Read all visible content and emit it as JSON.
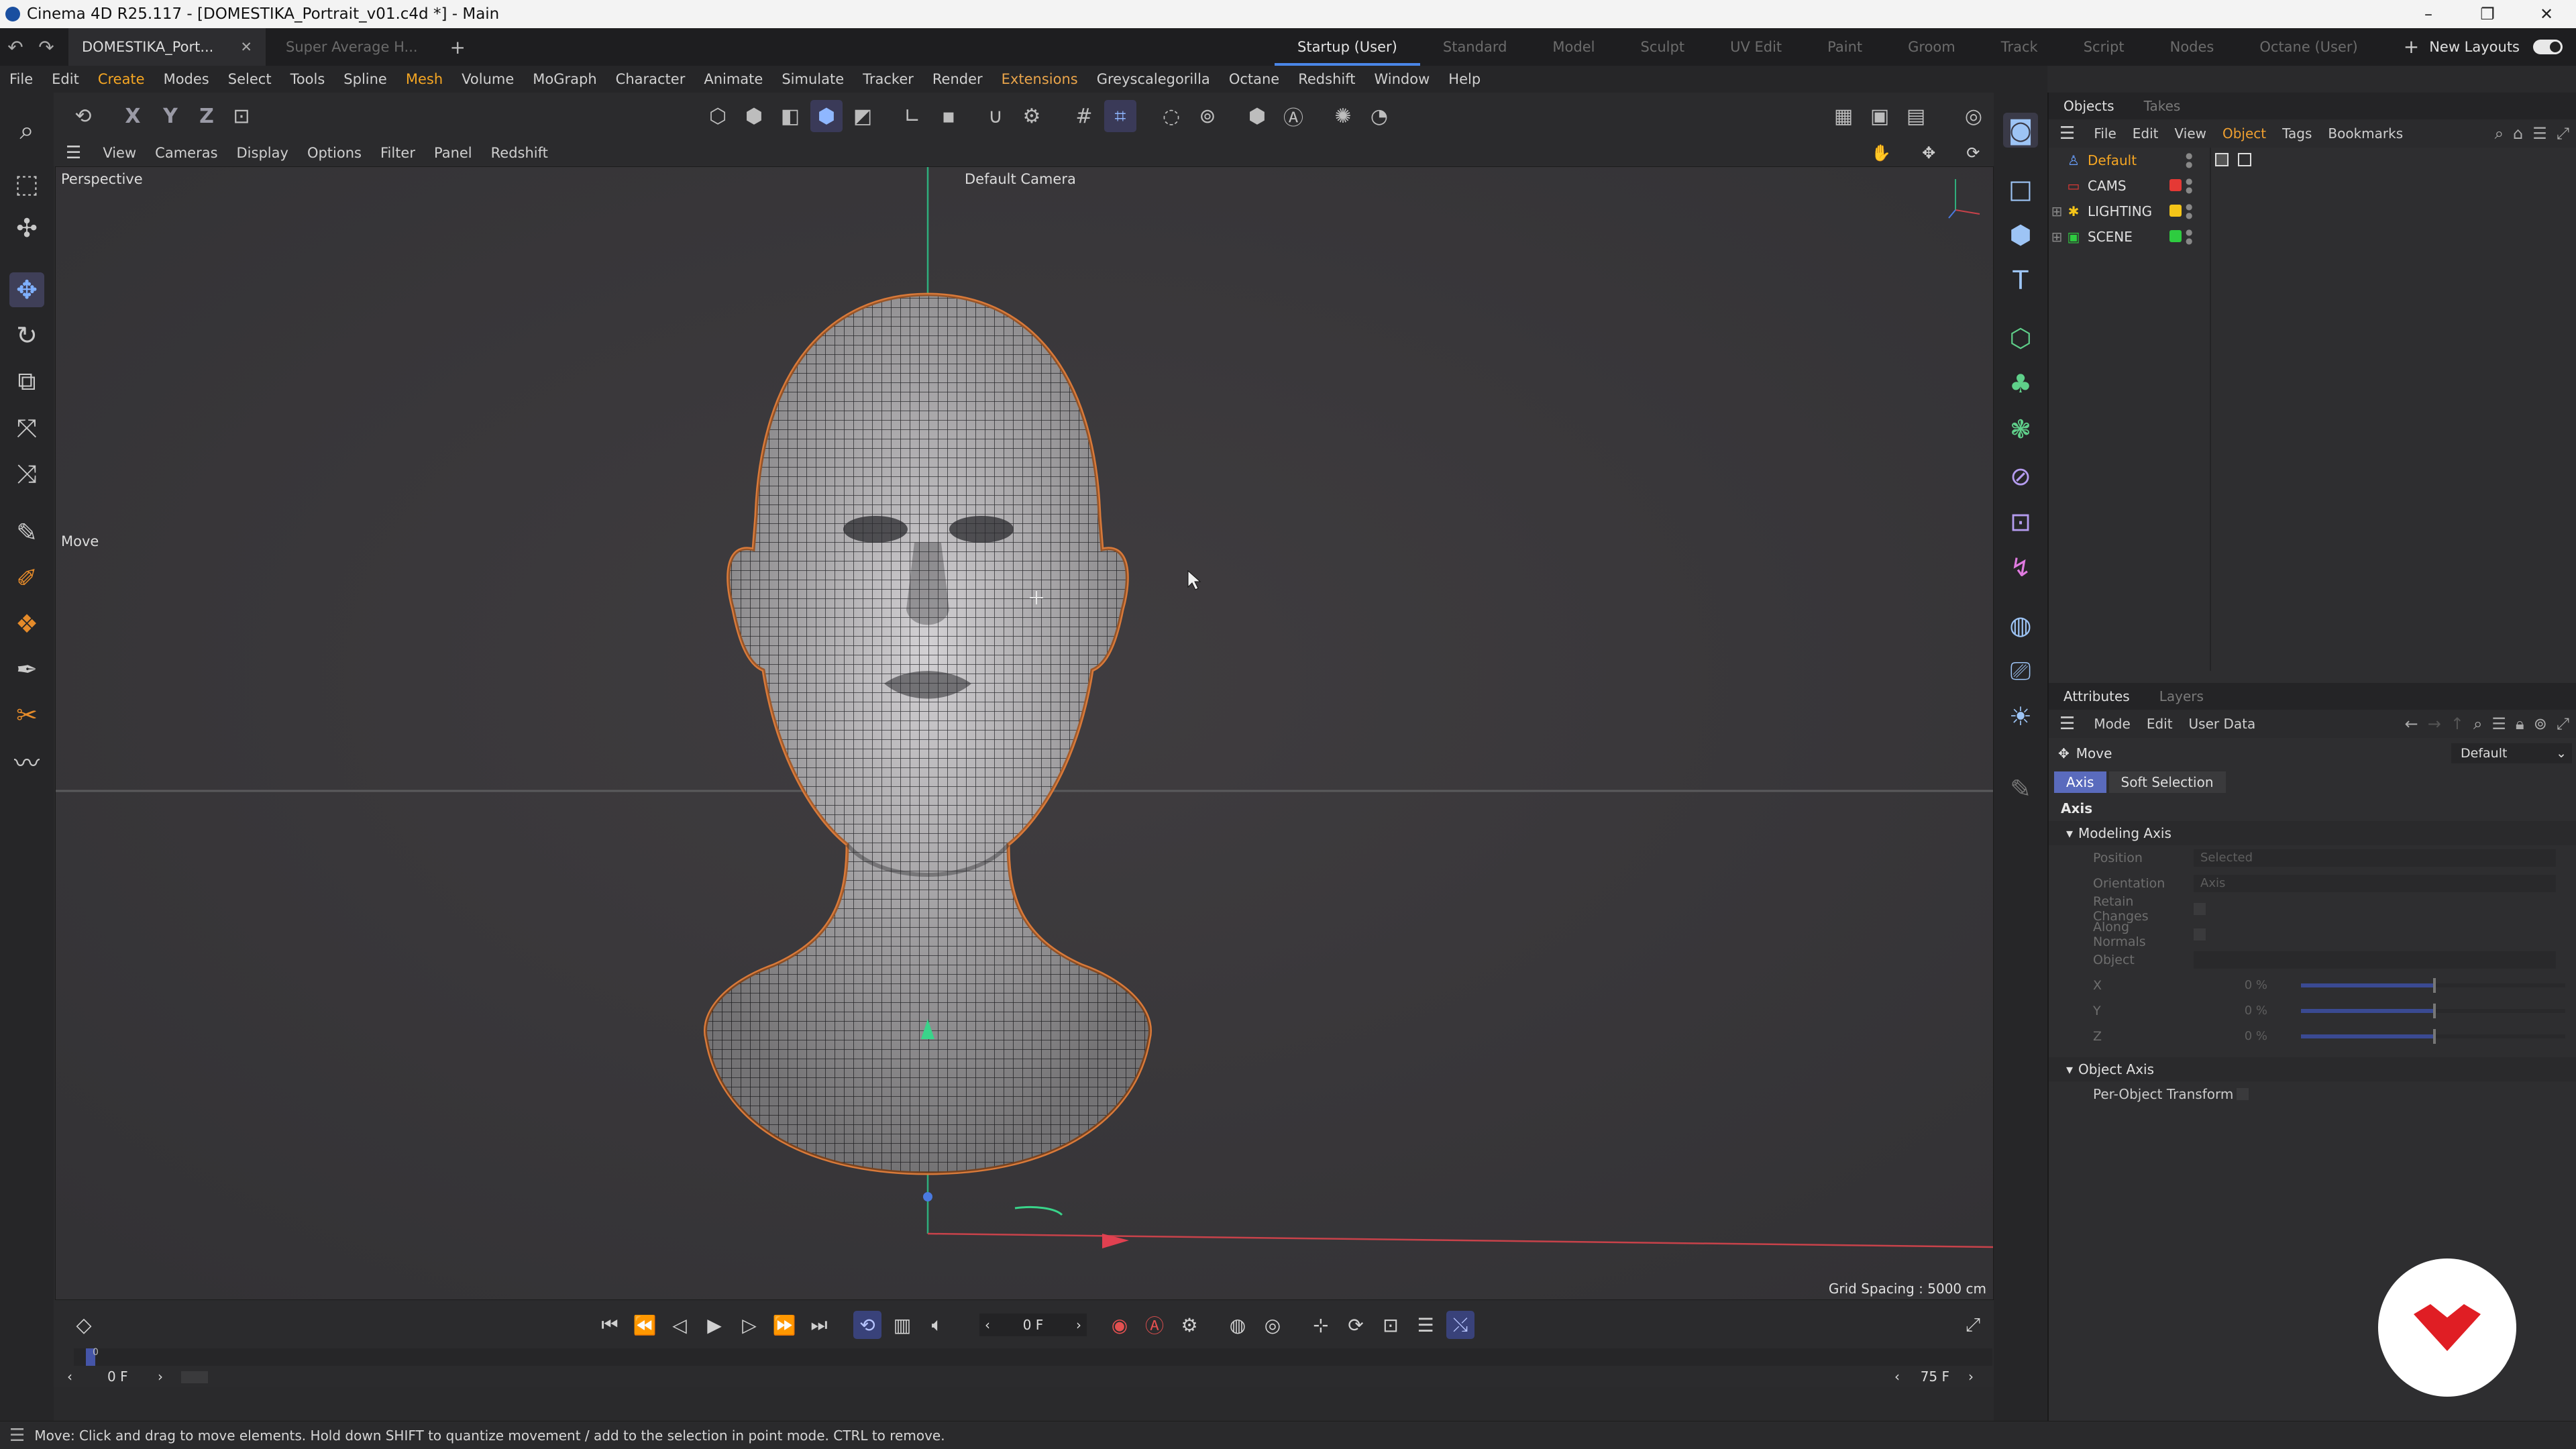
{
  "titlebar": {
    "title": "Cinema 4D R25.117 - [DOMESTIKA_Portrait_v01.c4d *] - Main"
  },
  "tabs": {
    "doc_active": "DOMESTIKA_Port...",
    "doc_inactive": "Super Average H...",
    "layouts": [
      "Startup (User)",
      "Standard",
      "Model",
      "Sculpt",
      "UV Edit",
      "Paint",
      "Groom",
      "Track",
      "Script",
      "Nodes",
      "Octane (User)"
    ],
    "new_layouts": "New Layouts"
  },
  "menu": [
    "File",
    "Edit",
    "Create",
    "Modes",
    "Select",
    "Tools",
    "Spline",
    "Mesh",
    "Volume",
    "MoGraph",
    "Character",
    "Animate",
    "Simulate",
    "Tracker",
    "Render",
    "Extensions",
    "Greyscalegorilla",
    "Octane",
    "Redshift",
    "Window",
    "Help"
  ],
  "toolbar": {
    "x": "X",
    "y": "Y",
    "z": "Z"
  },
  "viewport_menu": [
    "View",
    "Cameras",
    "Display",
    "Options",
    "Filter",
    "Panel",
    "Redshift"
  ],
  "viewport": {
    "name": "Perspective",
    "camera": "Default Camera",
    "tool": "Move",
    "grid_spacing": "Grid Spacing : 5000 cm"
  },
  "objects_panel": {
    "tabs": [
      "Objects",
      "Takes"
    ],
    "menu": [
      "File",
      "Edit",
      "View",
      "Object",
      "Tags",
      "Bookmarks"
    ],
    "items": [
      {
        "name": "Default",
        "color": "",
        "selected": true
      },
      {
        "name": "CAMS",
        "color": "#e53935"
      },
      {
        "name": "LIGHTING",
        "color": "#f5c518"
      },
      {
        "name": "SCENE",
        "color": "#2ecc40"
      }
    ]
  },
  "attributes_panel": {
    "tabs": [
      "Attributes",
      "Layers"
    ],
    "menu": [
      "Mode",
      "Edit",
      "User Data"
    ],
    "tool": "Move",
    "preset": "Default",
    "subtabs": [
      "Axis",
      "Soft Selection"
    ],
    "section": "Axis",
    "modeling_axis": {
      "title": "Modeling Axis",
      "position_label": "Position",
      "position_value": "Selected",
      "orientation_label": "Orientation",
      "orientation_value": "Axis",
      "retain_label": "Retain Changes",
      "normals_label": "Along Normals",
      "object_label": "Object",
      "x_label": "X",
      "x_value": "0 %",
      "y_label": "Y",
      "y_value": "0 %",
      "z_label": "Z",
      "z_value": "0 %"
    },
    "object_axis": {
      "title": "Object Axis",
      "per_object_label": "Per-Object Transform"
    }
  },
  "timeline": {
    "current_frame": "0 F",
    "start_frame": "0 F",
    "end_frame": "75 F",
    "ruler_zero": "0"
  },
  "status": "Move: Click and drag to move elements. Hold down SHIFT to quantize movement / add to the selection in point mode. CTRL to remove."
}
